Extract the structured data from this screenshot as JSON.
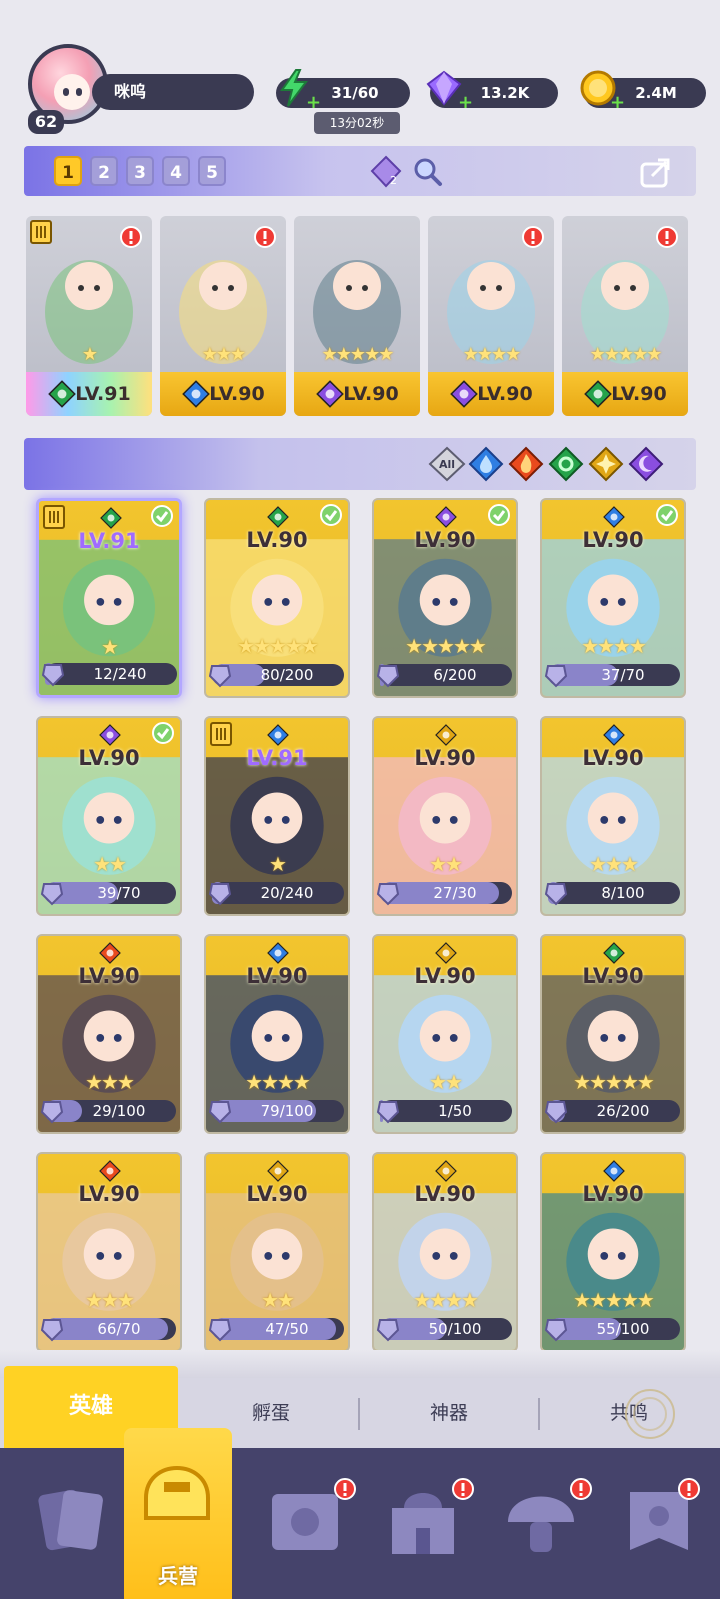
{
  "player": {
    "level": "62",
    "name": "咪呜"
  },
  "resources": {
    "stamina": "31/60",
    "timer": "13分02秒",
    "gems": "13.2K",
    "gold": "2.4M"
  },
  "team": {
    "slots": [
      "1",
      "2",
      "3",
      "4",
      "5"
    ],
    "active_slot": "1",
    "power_badge": "2",
    "cards": [
      {
        "level": "LV.91",
        "element": "wind",
        "stars": 1,
        "rank_badge": true,
        "alert": true,
        "bar": "rainbow"
      },
      {
        "level": "LV.90",
        "element": "water",
        "stars": 3,
        "alert": true
      },
      {
        "level": "LV.90",
        "element": "dark",
        "stars": 5,
        "alert": false
      },
      {
        "level": "LV.90",
        "element": "dark",
        "stars": 4,
        "alert": true
      },
      {
        "level": "LV.90",
        "element": "wind",
        "stars": 5,
        "alert": true
      }
    ]
  },
  "filters": {
    "all_label": "All",
    "elements": [
      "water",
      "fire",
      "wind",
      "light",
      "dark"
    ]
  },
  "heroes": [
    {
      "level": "LV.91",
      "element": "wind",
      "shards": "12/240",
      "progress": 0.05,
      "checked": true,
      "rank": true,
      "purple": true,
      "selected": true,
      "stars": 1,
      "bg": "#7ac27b"
    },
    {
      "level": "LV.90",
      "element": "wind",
      "shards": "80/200",
      "progress": 0.4,
      "checked": true,
      "stars": 5,
      "bg": "#f8df7a"
    },
    {
      "level": "LV.90",
      "element": "dark",
      "shards": "6/200",
      "progress": 0.03,
      "checked": true,
      "stars": 5,
      "bg": "#5f7d8a"
    },
    {
      "level": "LV.90",
      "element": "water",
      "shards": "37/70",
      "progress": 0.53,
      "checked": true,
      "stars": 4,
      "bg": "#9ad3ea"
    },
    {
      "level": "LV.90",
      "element": "dark",
      "shards": "39/70",
      "progress": 0.56,
      "checked": true,
      "stars": 2,
      "bg": "#9fe0cf"
    },
    {
      "level": "LV.91",
      "element": "water",
      "shards": "20/240",
      "progress": 0.08,
      "rank": true,
      "purple": true,
      "stars": 1,
      "bg": "#3b3c4f"
    },
    {
      "level": "LV.90",
      "element": "light",
      "shards": "27/30",
      "progress": 0.9,
      "stars": 2,
      "bg": "#f3b9c4"
    },
    {
      "level": "LV.90",
      "element": "water",
      "shards": "8/100",
      "progress": 0.08,
      "stars": 3,
      "bg": "#b7d9ef"
    },
    {
      "level": "LV.90",
      "element": "fire",
      "shards": "29/100",
      "progress": 0.29,
      "stars": 3,
      "bg": "#5b4d53"
    },
    {
      "level": "LV.90",
      "element": "water",
      "shards": "79/100",
      "progress": 0.79,
      "stars": 4,
      "bg": "#39496e"
    },
    {
      "level": "LV.90",
      "element": "light",
      "shards": "1/50",
      "progress": 0.02,
      "stars": 2,
      "bg": "#b6d6f0"
    },
    {
      "level": "LV.90",
      "element": "wind",
      "shards": "26/200",
      "progress": 0.13,
      "stars": 5,
      "bg": "#5b5e66"
    },
    {
      "level": "LV.90",
      "element": "fire",
      "shards": "66/70",
      "progress": 0.94,
      "stars": 3,
      "bg": "#e8c89e"
    },
    {
      "level": "LV.90",
      "element": "light",
      "shards": "47/50",
      "progress": 0.94,
      "stars": 2,
      "bg": "#e4c08a"
    },
    {
      "level": "LV.90",
      "element": "light",
      "shards": "50/100",
      "progress": 0.5,
      "stars": 4,
      "bg": "#c2d3ea"
    },
    {
      "level": "LV.90",
      "element": "water",
      "shards": "55/100",
      "progress": 0.55,
      "stars": 5,
      "bg": "#4a8a8a"
    }
  ],
  "tabs": {
    "heroes": "英雄",
    "hatch": "孵蛋",
    "artifact": "神器",
    "resonance": "共鸣"
  },
  "nav": {
    "barracks": "兵营"
  },
  "colors": {
    "water": "#2f7ee3",
    "fire": "#e94a1d",
    "wind": "#25a34a",
    "light": "#e0a615",
    "dark": "#8a4ee0",
    "accent": "#ffc928",
    "panel": "#3a3a52"
  }
}
